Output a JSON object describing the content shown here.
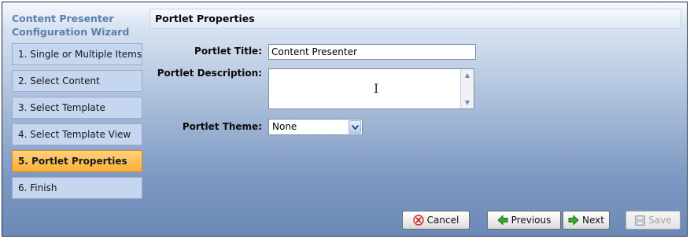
{
  "wizard": {
    "title_line1": "Content Presenter",
    "title_line2": "Configuration Wizard"
  },
  "steps": [
    {
      "label": "1. Single or Multiple Items",
      "active": false
    },
    {
      "label": "2. Select Content",
      "active": false
    },
    {
      "label": "3. Select Template",
      "active": false
    },
    {
      "label": "4. Select Template View",
      "active": false
    },
    {
      "label": "5. Portlet Properties",
      "active": true
    },
    {
      "label": "6. Finish",
      "active": false
    }
  ],
  "section": {
    "title": "Portlet Properties"
  },
  "form": {
    "title_label": "Portlet Title:",
    "title_value": "Content Presenter",
    "description_label": "Portlet Description:",
    "description_value": "",
    "theme_label": "Portlet Theme:",
    "theme_value": "None"
  },
  "buttons": {
    "cancel": "Cancel",
    "previous": "Previous",
    "next": "Next",
    "save": "Save"
  },
  "colors": {
    "active_step": "#f8ae3a",
    "step_bg": "#c6d6ef",
    "title_text": "#5a7eb0"
  },
  "icons": {
    "cancel": "cancel-x-icon",
    "previous": "green-arrow-left-icon",
    "next": "green-arrow-right-icon",
    "save": "floppy-disk-icon"
  }
}
